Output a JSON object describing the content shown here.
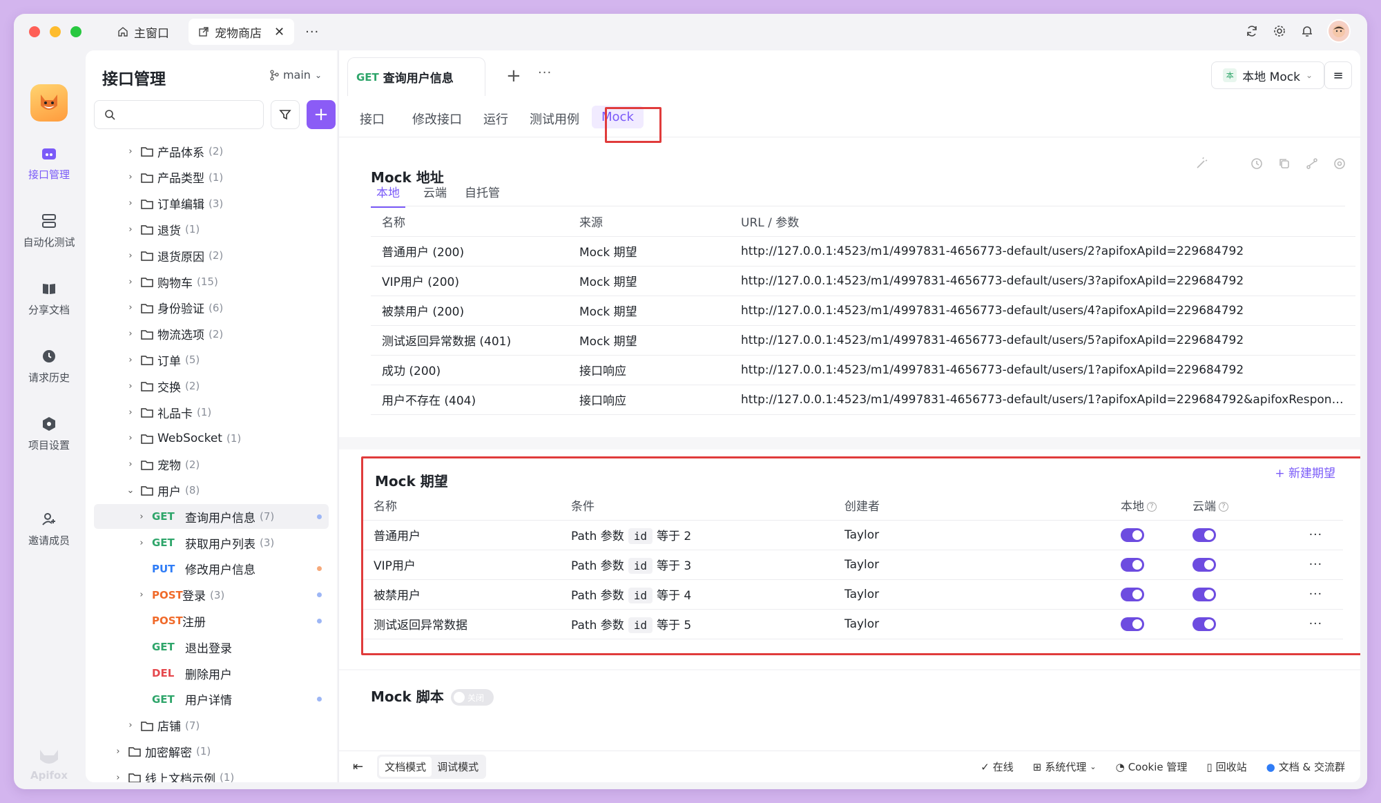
{
  "window": {
    "tabs": [
      {
        "label": "主窗口",
        "icon": "home-icon"
      },
      {
        "label": "宠物商店",
        "icon": "external-link-icon"
      }
    ]
  },
  "rail": {
    "items": [
      {
        "label": "接口管理",
        "icon": "api-icon",
        "active": true
      },
      {
        "label": "自动化测试",
        "icon": "automation-icon"
      },
      {
        "label": "分享文档",
        "icon": "book-icon"
      },
      {
        "label": "请求历史",
        "icon": "clock-icon"
      },
      {
        "label": "项目设置",
        "icon": "settings-hex-icon"
      },
      {
        "label": "邀请成员",
        "icon": "add-user-icon"
      }
    ],
    "brand": "Apifox"
  },
  "sidebar": {
    "title": "接口管理",
    "branch": "main",
    "search_placeholder": "",
    "tree": [
      {
        "type": "folder",
        "label": "产品体系",
        "count": "(2)",
        "level": 1
      },
      {
        "type": "folder",
        "label": "产品类型",
        "count": "(1)",
        "level": 1
      },
      {
        "type": "folder",
        "label": "订单编辑",
        "count": "(3)",
        "level": 1
      },
      {
        "type": "folder",
        "label": "退货",
        "count": "(1)",
        "level": 1
      },
      {
        "type": "folder",
        "label": "退货原因",
        "count": "(2)",
        "level": 1
      },
      {
        "type": "folder",
        "label": "购物车",
        "count": "(15)",
        "level": 1
      },
      {
        "type": "folder",
        "label": "身份验证",
        "count": "(6)",
        "level": 1
      },
      {
        "type": "folder",
        "label": "物流选项",
        "count": "(2)",
        "level": 1
      },
      {
        "type": "folder",
        "label": "订单",
        "count": "(5)",
        "level": 1
      },
      {
        "type": "folder",
        "label": "交换",
        "count": "(2)",
        "level": 1
      },
      {
        "type": "folder",
        "label": "礼品卡",
        "count": "(1)",
        "level": 1
      },
      {
        "type": "folder",
        "label": "WebSocket",
        "count": "(1)",
        "level": 1
      },
      {
        "type": "folder",
        "label": "宠物",
        "count": "(2)",
        "level": 1
      },
      {
        "type": "folder",
        "label": "用户",
        "count": "(8)",
        "level": 1,
        "open": true
      },
      {
        "type": "api",
        "method": "GET",
        "label": "查询用户信息",
        "count": "(7)",
        "level": 2,
        "chev": true,
        "selected": true,
        "dot": "#9db6f5"
      },
      {
        "type": "api",
        "method": "GET",
        "label": "获取用户列表",
        "count": "(3)",
        "level": 2,
        "chev": true
      },
      {
        "type": "api",
        "method": "PUT",
        "label": "修改用户信息",
        "count": "",
        "level": 2,
        "dot": "#f6a97a"
      },
      {
        "type": "api",
        "method": "POST",
        "label": "登录",
        "count": "(3)",
        "level": 2,
        "chev": true,
        "dot": "#9db6f5"
      },
      {
        "type": "api",
        "method": "POST",
        "label": "注册",
        "count": "",
        "level": 2,
        "dot": "#9db6f5"
      },
      {
        "type": "api",
        "method": "GET",
        "label": "退出登录",
        "count": "",
        "level": 2
      },
      {
        "type": "api",
        "method": "DEL",
        "label": "删除用户",
        "count": "",
        "level": 2
      },
      {
        "type": "api",
        "method": "GET",
        "label": "用户详情",
        "count": "",
        "level": 2,
        "dot": "#9db6f5"
      },
      {
        "type": "folder",
        "label": "店铺",
        "count": "(7)",
        "level": 1
      },
      {
        "type": "folder",
        "label": "加密解密",
        "count": "(1)",
        "level": 0
      },
      {
        "type": "folder",
        "label": "线上文档示例",
        "count": "(1)",
        "level": 0
      }
    ]
  },
  "main": {
    "doc_tab": {
      "method": "GET",
      "title": "查询用户信息"
    },
    "env": {
      "badge": "本",
      "label": "本地 Mock"
    },
    "sub_tabs": [
      "接口",
      "修改接口",
      "运行",
      "测试用例",
      "Mock"
    ],
    "mock_address": {
      "title": "Mock 地址",
      "source_tabs": [
        "本地",
        "云端",
        "自托管"
      ],
      "columns": [
        "名称",
        "来源",
        "URL / 参数"
      ],
      "rows": [
        [
          "普通用户 (200)",
          "Mock 期望",
          "http://127.0.0.1:4523/m1/4997831-4656773-default/users/2?apifoxApiId=229684792"
        ],
        [
          "VIP用户 (200)",
          "Mock 期望",
          "http://127.0.0.1:4523/m1/4997831-4656773-default/users/3?apifoxApiId=229684792"
        ],
        [
          "被禁用户 (200)",
          "Mock 期望",
          "http://127.0.0.1:4523/m1/4997831-4656773-default/users/4?apifoxApiId=229684792"
        ],
        [
          "测试返回异常数据 (401)",
          "Mock 期望",
          "http://127.0.0.1:4523/m1/4997831-4656773-default/users/5?apifoxApiId=229684792"
        ],
        [
          "成功 (200)",
          "接口响应",
          "http://127.0.0.1:4523/m1/4997831-4656773-default/users/1?apifoxApiId=229684792"
        ],
        [
          "用户不存在 (404)",
          "接口响应",
          "http://127.0.0.1:4523/m1/4997831-4656773-default/users/1?apifoxApiId=229684792&apifoxResponseId=..."
        ]
      ]
    },
    "mock_expect": {
      "title": "Mock 期望",
      "new_label": "+ 新建期望",
      "columns": [
        "名称",
        "条件",
        "创建者",
        "本地",
        "云端"
      ],
      "cond_prefix": "Path 参数",
      "cond_param": "id",
      "rows": [
        {
          "name": "普通用户",
          "cond_value": "等于 2",
          "creator": "Taylor",
          "local": true,
          "cloud": true
        },
        {
          "name": "VIP用户",
          "cond_value": "等于 3",
          "creator": "Taylor",
          "local": true,
          "cloud": true
        },
        {
          "name": "被禁用户",
          "cond_value": "等于 4",
          "creator": "Taylor",
          "local": true,
          "cloud": true
        },
        {
          "name": "测试返回异常数据",
          "cond_value": "等于 5",
          "creator": "Taylor",
          "local": true,
          "cloud": true
        }
      ]
    },
    "mock_script": {
      "title": "Mock 脚本",
      "toggle_label": "关闭"
    }
  },
  "status_bar": {
    "modes": [
      "文档模式",
      "调试模式"
    ],
    "items": [
      {
        "label": "在线",
        "icon": "check-circle-icon"
      },
      {
        "label": "系统代理",
        "icon": "proxy-icon"
      },
      {
        "label": "Cookie 管理",
        "icon": "cookie-icon"
      },
      {
        "label": "回收站",
        "icon": "trash-icon"
      },
      {
        "label": "文档 & 交流群",
        "icon": "chat-icon"
      }
    ]
  },
  "colors": {
    "accent": "#7a5af8",
    "get": "#2ea56a",
    "put": "#2f7cf6",
    "post": "#f06a2a",
    "del": "#e5484d",
    "highlight": "#e03b3b"
  }
}
